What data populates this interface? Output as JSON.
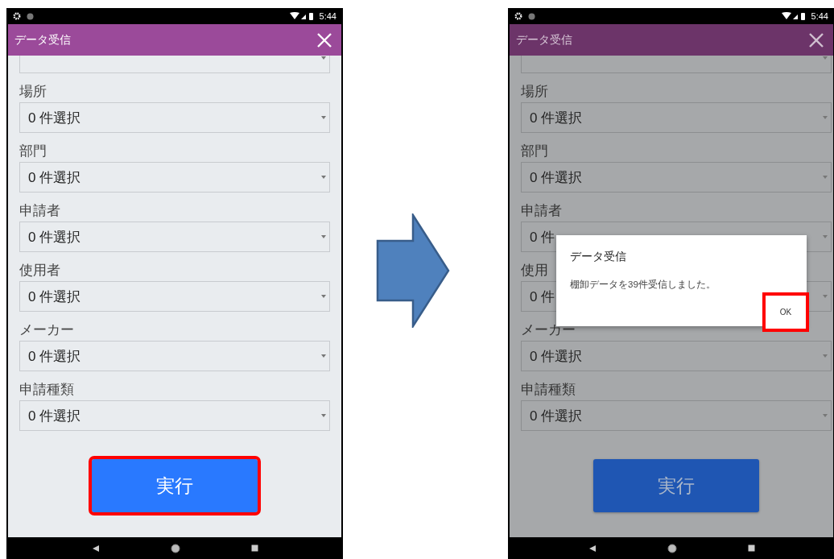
{
  "screens": [
    {
      "time": "5:44",
      "title": "データ受信",
      "dimmed": false,
      "field_above_scrolled": true,
      "fields": [
        {
          "label": "場所",
          "value": "0 件選択"
        },
        {
          "label": "部門",
          "value": "0 件選択"
        },
        {
          "label": "申請者",
          "value": "0 件選択"
        },
        {
          "label": "使用者",
          "value": "0 件選択"
        },
        {
          "label": "メーカー",
          "value": "0 件選択"
        },
        {
          "label": "申請種類",
          "value": "0 件選択"
        }
      ],
      "execute_button": {
        "label": "実行",
        "highlighted": true
      }
    },
    {
      "time": "5:44",
      "title": "データ受信",
      "dimmed": true,
      "field_above_scrolled": true,
      "fields": [
        {
          "label": "場所",
          "value": "0 件選択"
        },
        {
          "label": "部門",
          "value": "0 件選択"
        },
        {
          "label": "申請者",
          "value": "0 件"
        },
        {
          "label": "使用",
          "value": "0 件"
        },
        {
          "label": "メーカー",
          "value": "0 件選択"
        },
        {
          "label": "申請種類",
          "value": "0 件選択"
        }
      ],
      "execute_button": {
        "label": "実行",
        "highlighted": false
      },
      "dialog": {
        "title": "データ受信",
        "message": "棚卸データを39件受信しました。",
        "ok_button": {
          "label": "OK",
          "highlighted": true
        }
      }
    }
  ]
}
